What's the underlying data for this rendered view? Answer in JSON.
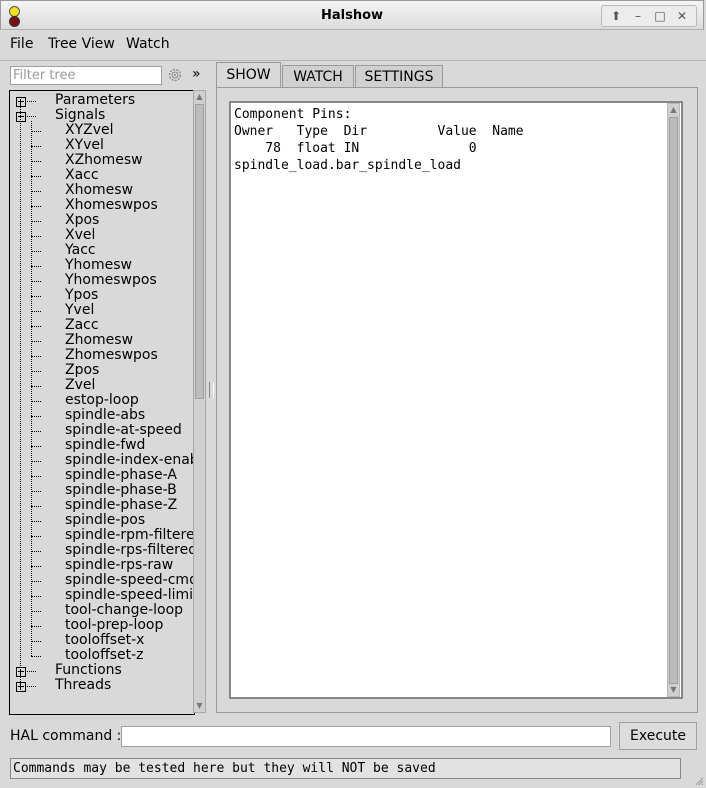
{
  "window": {
    "title": "Halshow"
  },
  "menubar": {
    "items": [
      "File",
      "Tree View",
      "Watch"
    ]
  },
  "filter": {
    "placeholder": "Filter tree"
  },
  "tree": {
    "top_nodes": {
      "parameters": "Parameters",
      "signals": "Signals",
      "functions": "Functions",
      "threads": "Threads"
    },
    "signals": [
      "XYZvel",
      "XYvel",
      "XZhomesw",
      "Xacc",
      "Xhomesw",
      "Xhomeswpos",
      "Xpos",
      "Xvel",
      "Yacc",
      "Yhomesw",
      "Yhomeswpos",
      "Ypos",
      "Yvel",
      "Zacc",
      "Zhomesw",
      "Zhomeswpos",
      "Zpos",
      "Zvel",
      "estop-loop",
      "spindle-abs",
      "spindle-at-speed",
      "spindle-fwd",
      "spindle-index-enab",
      "spindle-phase-A",
      "spindle-phase-B",
      "spindle-phase-Z",
      "spindle-pos",
      "spindle-rpm-filtered",
      "spindle-rps-filtered",
      "spindle-rps-raw",
      "spindle-speed-cmd",
      "spindle-speed-limit",
      "tool-change-loop",
      "tool-prep-loop",
      "tooloffset-x",
      "tooloffset-z"
    ]
  },
  "tabs": [
    "SHOW",
    "WATCH",
    "SETTINGS"
  ],
  "show_panel": {
    "lines": [
      "Component Pins:",
      "Owner   Type  Dir         Value  Name",
      "    78  float IN              0",
      "spindle_load.bar_spindle_load"
    ]
  },
  "command": {
    "label": "HAL command :",
    "value": "",
    "execute_label": "Execute"
  },
  "status": {
    "text": "Commands may be tested here but they will NOT be saved"
  },
  "colors": {
    "window_bg": "#d9d9d9",
    "text_area_bg": "#ffffff"
  }
}
